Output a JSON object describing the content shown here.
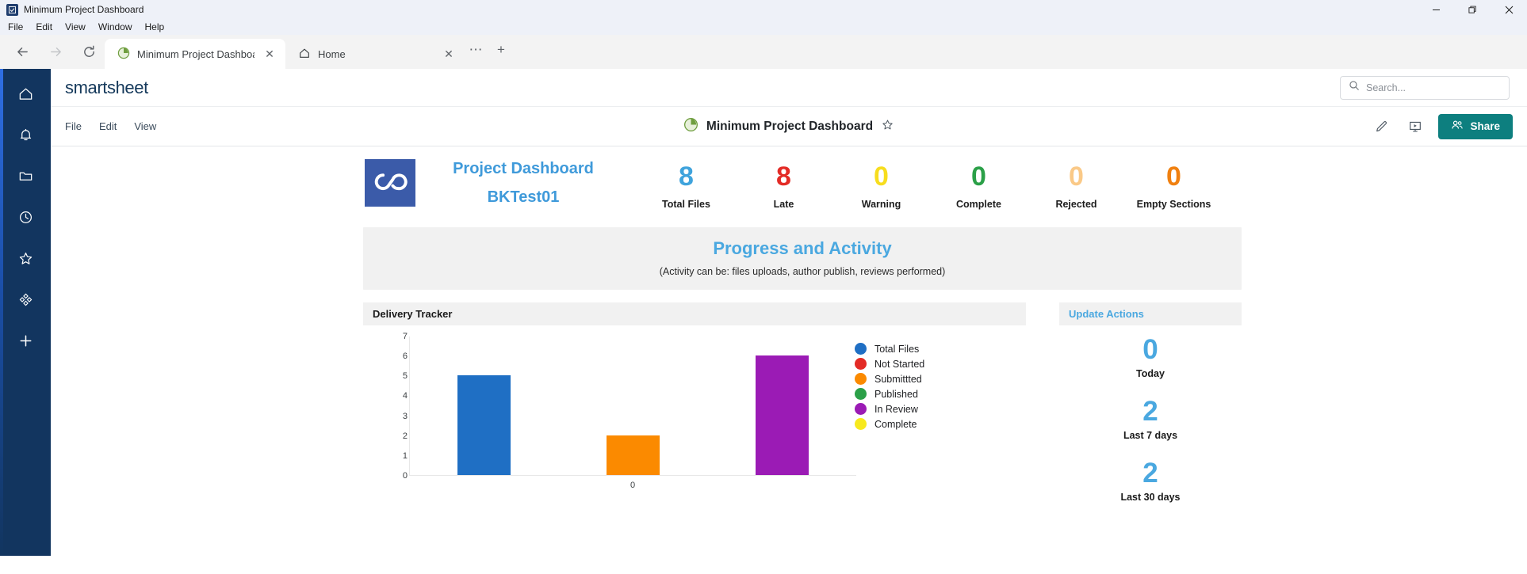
{
  "window": {
    "title": "Minimum Project Dashboard",
    "app_icon": "smartsheet-app-icon",
    "controls": {
      "minimize": "—",
      "maximize": "❐",
      "close": "✕"
    }
  },
  "menubar": {
    "items": [
      "File",
      "Edit",
      "View",
      "Window",
      "Help"
    ]
  },
  "browser": {
    "nav": {
      "back": "←",
      "forward": "→",
      "reload": "↻"
    },
    "tabs": [
      {
        "label": "Minimum Project Dashboa",
        "icon": "pie-chart-icon",
        "active": true,
        "close": "✕"
      },
      {
        "label": "Home",
        "icon": "home-icon",
        "active": false,
        "close": "✕"
      }
    ],
    "tab_overflow": "⋯",
    "new_tab": "+"
  },
  "sidebar": {
    "items": [
      {
        "name": "home",
        "icon": "home-icon"
      },
      {
        "name": "notifications",
        "icon": "bell-icon"
      },
      {
        "name": "browse",
        "icon": "folder-icon"
      },
      {
        "name": "recents",
        "icon": "clock-icon"
      },
      {
        "name": "favorites",
        "icon": "star-icon"
      },
      {
        "name": "solutions",
        "icon": "solutions-diamond-icon"
      },
      {
        "name": "create",
        "icon": "plus-icon"
      }
    ]
  },
  "header": {
    "logo": "smartsheet",
    "search": {
      "placeholder": "Search...",
      "value": "",
      "icon": "search-icon"
    }
  },
  "toolbar": {
    "menu": [
      "File",
      "Edit",
      "View"
    ],
    "doc_title": "Minimum Project Dashboard",
    "doc_icon": "pie-chart-icon",
    "favorite_icon": "star-outline-icon",
    "edit_icon": "pencil-icon",
    "present_icon": "presentation-icon",
    "share_label": "Share",
    "share_icon": "people-icon",
    "share_color": "#0d7f7f"
  },
  "dashboard": {
    "brand": {
      "logo_icon": "infinity-logo",
      "logo_bg": "#3b5ba9",
      "line1": "Project Dashboard",
      "line2": "BKTest01",
      "color": "#3f9ada"
    },
    "kpis": [
      {
        "value": "8",
        "label": "Total Files",
        "color": "#3fa3dc"
      },
      {
        "value": "8",
        "label": "Late",
        "color": "#e32b26"
      },
      {
        "value": "0",
        "label": "Warning",
        "color": "#f7dd1e"
      },
      {
        "value": "0",
        "label": "Complete",
        "color": "#2ba048"
      },
      {
        "value": "0",
        "label": "Rejected",
        "color": "#fac987"
      },
      {
        "value": "0",
        "label": "Empty Sections",
        "color": "#f08010"
      }
    ],
    "banner": {
      "title": "Progress and Activity",
      "subtitle": "(Activity can be: files uploads, author publish, reviews performed)",
      "title_color": "#4aa8e0"
    },
    "delivery_tracker": {
      "title": "Delivery Tracker"
    },
    "update_actions": {
      "title": "Update Actions",
      "title_color": "#4aa8e0",
      "stats": [
        {
          "value": "0",
          "label": "Today"
        },
        {
          "value": "2",
          "label": "Last 7 days"
        },
        {
          "value": "2",
          "label": "Last 30 days"
        }
      ]
    }
  },
  "chart_data": {
    "type": "bar",
    "title": "Delivery Tracker",
    "xlabel": "0",
    "ylabel": "",
    "categories": [
      "Total Files",
      "Submittted",
      "In Review"
    ],
    "values": [
      5,
      2,
      6
    ],
    "bar_colors": [
      "#1f6fc4",
      "#fb8a00",
      "#9b1bb5"
    ],
    "ylim": [
      0,
      7
    ],
    "yticks": [
      7,
      6,
      5,
      4,
      3,
      2,
      1,
      0
    ],
    "xticks": [
      "0"
    ],
    "grid": false,
    "legend_position": "right",
    "legend": [
      {
        "label": "Total Files",
        "color": "#1f6fc4"
      },
      {
        "label": "Not Started",
        "color": "#e32b26"
      },
      {
        "label": "Submittted",
        "color": "#fb8a00"
      },
      {
        "label": "Published",
        "color": "#2ba048"
      },
      {
        "label": "In Review",
        "color": "#9b1bb5"
      },
      {
        "label": "Complete",
        "color": "#f7e91e"
      }
    ]
  }
}
